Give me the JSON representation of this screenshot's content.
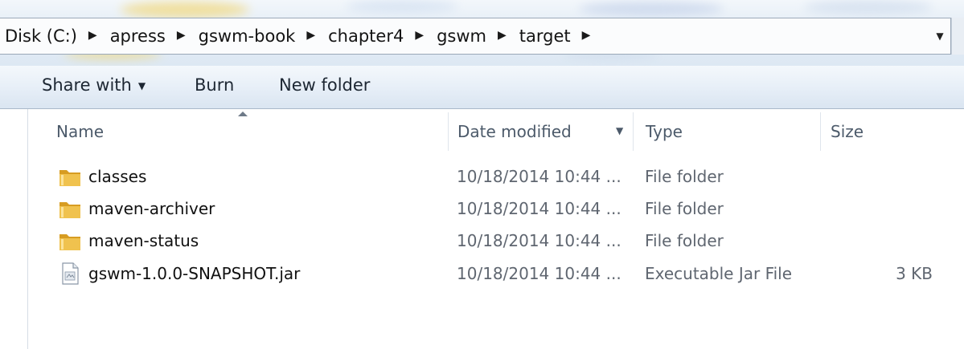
{
  "address_bar": {
    "crumbs": [
      "Disk (C:)",
      "apress",
      "gswm-book",
      "chapter4",
      "gswm",
      "target"
    ],
    "separator": "▶",
    "dropdown": "▼"
  },
  "toolbar": {
    "share_label": "Share with",
    "share_caret": "▼",
    "burn_label": "Burn",
    "new_folder_label": "New folder"
  },
  "columns": {
    "name": "Name",
    "date": "Date modified",
    "date_caret": "▼",
    "type": "Type",
    "size": "Size"
  },
  "files": [
    {
      "name": "classes",
      "date": "10/18/2014 10:44 ...",
      "type": "File folder",
      "size": "",
      "icon": "folder-icon"
    },
    {
      "name": "maven-archiver",
      "date": "10/18/2014 10:44 ...",
      "type": "File folder",
      "size": "",
      "icon": "folder-icon"
    },
    {
      "name": "maven-status",
      "date": "10/18/2014 10:44 ...",
      "type": "File folder",
      "size": "",
      "icon": "folder-icon"
    },
    {
      "name": "gswm-1.0.0-SNAPSHOT.jar",
      "date": "10/18/2014 10:44 ...",
      "type": "Executable Jar File",
      "size": "3 KB",
      "icon": "jar-file-icon"
    }
  ],
  "colors": {
    "folder": "#e9b63a",
    "toolbar_text": "#1d2733",
    "header_text": "#4c5a6a",
    "detail_text": "#5f6670"
  }
}
